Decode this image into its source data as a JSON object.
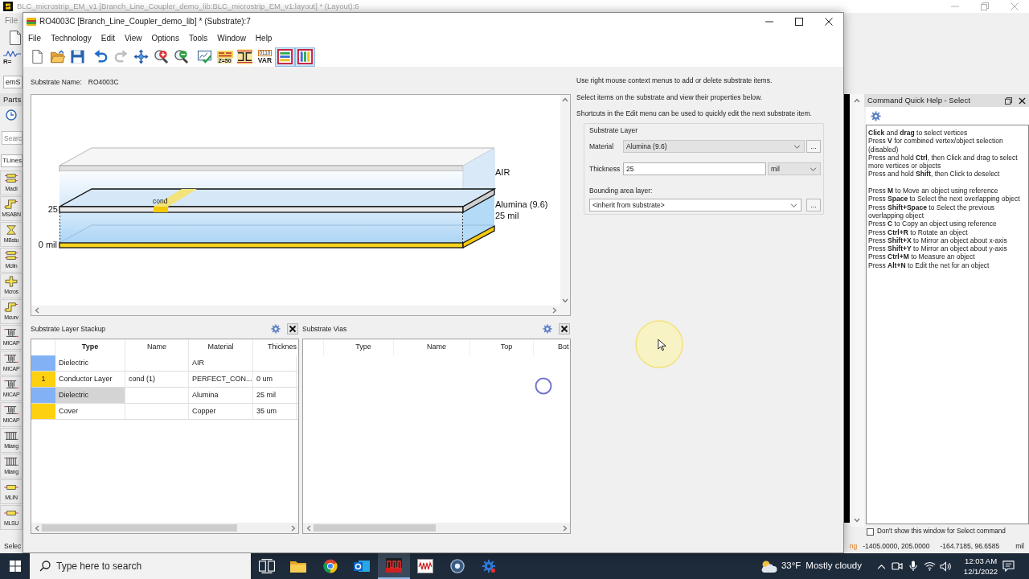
{
  "background_window": {
    "title": "BLC_microstrip_EM_v1 [Branch_Line_Coupler_demo_lib:BLC_microstrip_EM_v1:layout] * (Layout):6",
    "menu": [
      "File"
    ],
    "toolbar": [
      {
        "kind": "new"
      },
      {
        "kind": "resistor",
        "text": "R="
      }
    ],
    "combo": "emS",
    "parts": {
      "title": "Parts",
      "search_placeholder": "Searc",
      "library": "TLines",
      "items": [
        {
          "kind": "coupled",
          "label": "Macli"
        },
        {
          "kind": "bend",
          "label": "MSABN"
        },
        {
          "kind": "stub",
          "label": "MBstu"
        },
        {
          "kind": "coupled",
          "label": "Mclin"
        },
        {
          "kind": "cross",
          "label": "Mcros"
        },
        {
          "kind": "bend",
          "label": "Mcurv"
        },
        {
          "kind": "capacitor",
          "label": "MICAP"
        },
        {
          "kind": "capacitor",
          "label": "MICAP"
        },
        {
          "kind": "capacitor",
          "label": "MICAP"
        },
        {
          "kind": "capacitor",
          "label": "MICAP"
        },
        {
          "kind": "lange",
          "label": "Mlang"
        },
        {
          "kind": "lange",
          "label": "Mlang"
        },
        {
          "kind": "line",
          "label": "MLIN"
        },
        {
          "kind": "line",
          "label": "MLSU"
        }
      ]
    },
    "quick_help": {
      "title": "Command Quick Help - Select",
      "groups": [
        [
          "**Click** and **drag** to select vertices",
          "Press **V** for combined vertex/object selection (disabled)",
          "Press and hold **Ctrl**, then Click and drag to select more vertices or objects",
          "Press and hold **Shift**, then Click to deselect"
        ],
        [
          "Press **M** to Move an object using reference",
          "Press **Space** to Select the next overlapping object",
          "Press **Shift+Space** to Select the previous overlapping object",
          "Press **C** to Copy an object using reference",
          "Press **Ctrl+R** to Rotate an object",
          "Press **Shift+X** to Mirror an object about x-axis",
          "Press **Shift+Y** to Mirror an object about y-axis",
          "Press **Ctrl+M** to Measure an object",
          "Press **Alt+N** to Edit the net for an object"
        ]
      ],
      "dont_show": {
        "label": "Don't show this window for Select command",
        "checked": false
      }
    },
    "status_bar": {
      "prompt": "Selec",
      "mode": "ng",
      "coordinates": [
        "-1405.0000, 205.0000",
        "-164.7185, 96.6585"
      ],
      "unit": "mil"
    }
  },
  "substrate_window": {
    "title": "RO4003C [Branch_Line_Coupler_demo_lib] * (Substrate):7",
    "menu": [
      "File",
      "Technology",
      "Edit",
      "View",
      "Options",
      "Tools",
      "Window",
      "Help"
    ],
    "toolbar": [
      [
        {
          "kind": "new",
          "disabled": false
        },
        {
          "kind": "open",
          "disabled": false
        },
        {
          "kind": "save",
          "disabled": false
        }
      ],
      [
        {
          "kind": "undo",
          "disabled": false
        },
        {
          "kind": "redo",
          "disabled": true
        },
        {
          "kind": "move",
          "disabled": false
        },
        {
          "kind": "zoom_in",
          "disabled": false
        },
        {
          "kind": "zoom_out",
          "disabled": false
        }
      ],
      [
        {
          "kind": "check",
          "disabled": false
        },
        {
          "kind": "impedance",
          "text": "Z=50",
          "disabled": false
        },
        {
          "kind": "split",
          "disabled": false
        },
        {
          "kind": "variables",
          "text": "0110",
          "caption": "VAR",
          "disabled": false
        }
      ]
    ],
    "view_buttons": [
      {
        "kind": "stack_rows",
        "on": true
      },
      {
        "kind": "stack_columns",
        "on": true
      }
    ],
    "substrate_name": {
      "label": "Substrate Name:",
      "value": "RO4003C"
    },
    "preview": {
      "air_label": "AIR",
      "material_label": "Alumina (9.6)",
      "thickness_label": "25 mil",
      "top_mark": "25",
      "bottom_mark": "0 mil",
      "conductor_label": "cond"
    },
    "stackup": {
      "title": "Substrate Layer Stackup",
      "columns": [
        {
          "label": "Type",
          "selected": true
        },
        {
          "label": "Name",
          "selected": false
        },
        {
          "label": "Material",
          "selected": false
        },
        {
          "label": "Thicknes",
          "selected": false
        }
      ],
      "rows": [
        {
          "color": "#82b2f5",
          "type": "Dielectric",
          "material": "AIR",
          "selected": false
        },
        {
          "color": "#fdd10f",
          "number": "1",
          "type": "Conductor Layer",
          "name": "cond (1)",
          "material": "PERFECT_CON...",
          "thickness": "0 um",
          "selected": false
        },
        {
          "color": "#82b2f5",
          "type": "Dielectric",
          "material": "Alumina",
          "thickness": "25 mil",
          "selected": true
        },
        {
          "color": "#fdd10f",
          "type": "Cover",
          "material": "Copper",
          "thickness": "35 um",
          "selected": false
        }
      ]
    },
    "vias": {
      "title": "Substrate Vias",
      "columns": [
        "Type",
        "Name",
        "Top",
        "Bot"
      ]
    },
    "info": [
      "Use right mouse context menus to add or delete substrate items.",
      "Select items on the substrate and view their properties below.",
      "Shortcuts in the Edit menu can be used to quickly edit the next substrate item."
    ],
    "layer": {
      "title": "Substrate Layer",
      "material": {
        "label": "Material",
        "value": "Alumina (9.6)",
        "browse": "..."
      },
      "thickness": {
        "label": "Thickness",
        "value": "25",
        "unit": "mil"
      },
      "bounding": {
        "label": "Bounding area layer:",
        "value": "<inherit from substrate>",
        "browse": "..."
      }
    }
  },
  "taskbar": {
    "search_placeholder": "Type here to search",
    "apps": [
      {
        "kind": "task_view",
        "selected": false
      },
      {
        "kind": "folder",
        "selected": false
      },
      {
        "kind": "browser",
        "selected": false
      },
      {
        "kind": "mail",
        "selected": false
      },
      {
        "kind": "ads",
        "selected": true
      },
      {
        "kind": "data_display",
        "selected": false
      },
      {
        "kind": "circle",
        "selected": false
      },
      {
        "kind": "gear",
        "selected": false
      }
    ],
    "weather": {
      "temperature": "33°F",
      "condition": "Mostly cloudy"
    },
    "time": "12:03 AM",
    "date": "12/1/2022"
  }
}
